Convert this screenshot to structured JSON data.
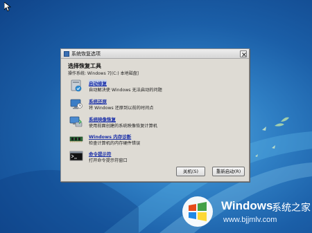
{
  "dialog": {
    "title": "系统恢复选项",
    "heading": "选择恢复工具",
    "os_line": "操作系统: Windows 7[(C:) 本地磁盘]",
    "tools": [
      {
        "label": "启动修复",
        "description": "自动解决使 Windows 无法启动的问题",
        "icon": "startup-repair-icon"
      },
      {
        "label": "系统还原",
        "description": "将 Windows 还原到以前的时间点",
        "icon": "system-restore-icon"
      },
      {
        "label": "系统映像恢复",
        "description": "使用前面创建的系统映像恢复计算机",
        "icon": "system-image-recovery-icon"
      },
      {
        "label": "Windows 内存诊断",
        "description": "检查计算机的内存硬件错误",
        "icon": "memory-diagnostic-icon"
      },
      {
        "label": "命令提示符",
        "description": "打开命令提示符窗口",
        "icon": "command-prompt-icon"
      }
    ],
    "buttons": {
      "shutdown": "关机(S)",
      "restart": "重新启动(R)"
    }
  },
  "watermark": {
    "brand_name": "Windows",
    "brand_cn": "系统之家",
    "url": "www.bjjmlv.com"
  },
  "colors": {
    "desktop": "#1b5fa8",
    "dialog_bg": "#dedbd4",
    "link": "#1a2fa8"
  }
}
